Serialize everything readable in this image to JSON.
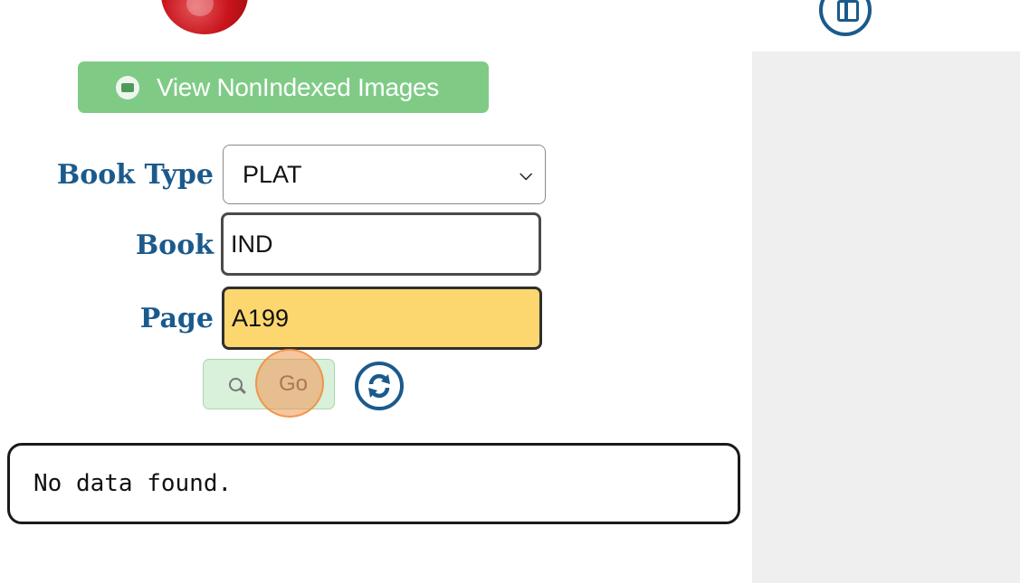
{
  "header": {
    "logo_icon": "red-seal-logo",
    "top_icon": "book-icon"
  },
  "actions": {
    "view_nonindexed_label": "View NonIndexed Images",
    "view_nonindexed_icon": "folder-icon"
  },
  "form": {
    "book_type_label": "Book Type",
    "book_type_value": "PLAT",
    "book_label": "Book",
    "book_value": "IND",
    "page_label": "Page",
    "page_value": "A199",
    "go_label": "Go",
    "search_icon": "search-icon",
    "refresh_icon": "refresh-icon"
  },
  "results": {
    "message": "No data found."
  },
  "colors": {
    "label_blue": "#1b5a8c",
    "button_green": "#7fcb86",
    "active_field": "#fcd770",
    "panel_gray": "#efefef"
  }
}
